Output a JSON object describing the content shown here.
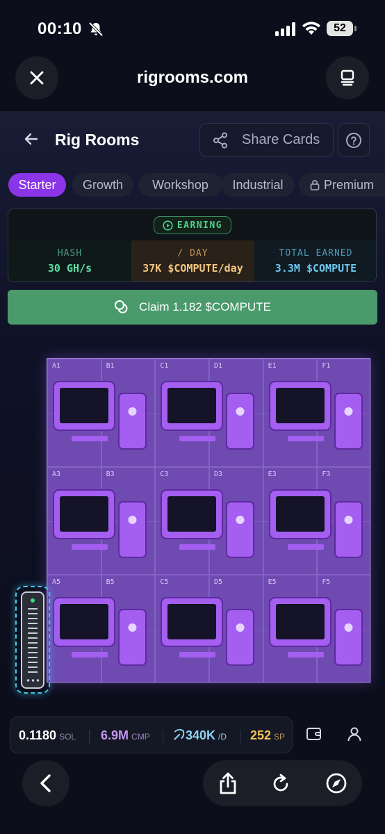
{
  "status_bar": {
    "time": "00:10",
    "battery": "52"
  },
  "browser": {
    "url": "rigrooms.com"
  },
  "header": {
    "title": "Rig Rooms",
    "share_label": "Share Cards"
  },
  "tabs": [
    {
      "label": "Starter",
      "active": true
    },
    {
      "label": "Growth",
      "active": false
    },
    {
      "label": "Workshop",
      "active": false
    },
    {
      "label": "Industrial",
      "active": false
    },
    {
      "label": "Premium",
      "active": false,
      "locked": true
    }
  ],
  "earnings": {
    "badge": "EARNING",
    "hash_label": "HASH",
    "hash_value": "30 GH/s",
    "day_label": "/ DAY",
    "day_value": "37K $COMPUTE/day",
    "total_label": "TOTAL EARNED",
    "total_value": "3.3M $COMPUTE"
  },
  "claim": {
    "label": "Claim 1.182 $COMPUTE"
  },
  "grid": {
    "cells": [
      "A1",
      "B1",
      "C1",
      "D1",
      "E1",
      "F1",
      "A3",
      "B3",
      "C3",
      "D3",
      "E3",
      "F3",
      "A5",
      "B5",
      "C5",
      "D5",
      "E5",
      "F5"
    ],
    "rigs": 9
  },
  "wallet": {
    "sol_value": "0.1180",
    "sol_unit": "SOL",
    "cmp_value": "6.9M",
    "cmp_unit": "CMP",
    "rate_value": "340K",
    "rate_unit": "/D",
    "sp_value": "252",
    "sp_unit": "SP"
  },
  "colors": {
    "accent": "#8a35e8",
    "claim": "#4a9a6b",
    "room": "#6e4ab1",
    "rig": "#a45ef0"
  }
}
